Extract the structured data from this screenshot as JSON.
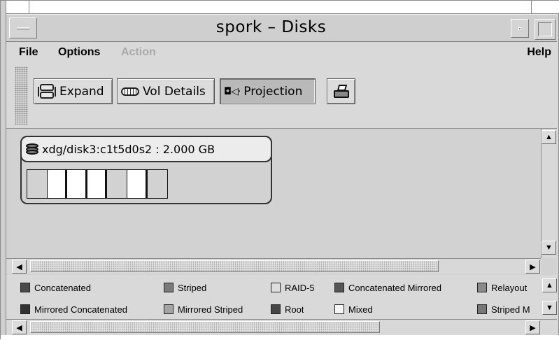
{
  "window": {
    "title": "spork – Disks"
  },
  "menu": {
    "file": "File",
    "options": "Options",
    "action": "Action",
    "help": "Help"
  },
  "toolbar": {
    "expand_label": "Expand",
    "vol_details_label": "Vol Details",
    "projection_label": "Projection",
    "expand_icon": "expand-icon",
    "vol_details_icon": "vol-details-icon",
    "projection_icon": "projection-icon",
    "print_icon": "printer-icon"
  },
  "disk": {
    "label": "xdg/disk3:c1t5d0s2 : 2.000 GB",
    "icon": "disk-icon",
    "segments": [
      "grey",
      "white",
      "white",
      "white",
      "grey",
      "white",
      "grey"
    ]
  },
  "legend": {
    "row1": [
      {
        "label": "Concatenated",
        "color": "#4a4a4a"
      },
      {
        "label": "Striped",
        "color": "#7a7a7a"
      },
      {
        "label": "RAID-5",
        "color": "#dedede"
      },
      {
        "label": "Concatenated Mirrored",
        "color": "#555555"
      },
      {
        "label": "Relayout",
        "color": "#8a8a8a"
      }
    ],
    "row2": [
      {
        "label": "Mirrored Concatenated",
        "color": "#333333"
      },
      {
        "label": "Mirrored Striped",
        "color": "#a5a5a5"
      },
      {
        "label": "Root",
        "color": "#444444"
      },
      {
        "label": "Mixed",
        "color": "#f5f5f5"
      },
      {
        "label": "Striped M",
        "color": "#777777"
      }
    ]
  }
}
